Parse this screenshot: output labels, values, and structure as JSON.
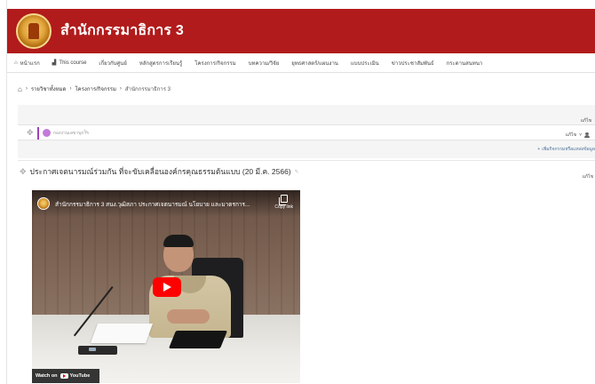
{
  "header": {
    "site_title": "สำนักกรรมาธิการ 3"
  },
  "nav": {
    "items": [
      {
        "icon": "home-icon",
        "label": "หน้าแรก"
      },
      {
        "icon": "chart-icon",
        "label": "This course"
      },
      {
        "label": "เกี่ยวกับศูนย์"
      },
      {
        "label": "หลักสูตรการเรียนรู้"
      },
      {
        "label": "โครงการ/กิจกรรม"
      },
      {
        "label": "บทความ/วิจัย"
      },
      {
        "label": "ยุทธศาสตร์/แผนงาน"
      },
      {
        "label": "แบบประเมิน"
      },
      {
        "label": "ข่าวประชาสัมพันธ์"
      },
      {
        "label": "กระดานสนทนา"
      }
    ]
  },
  "breadcrumb": {
    "items": [
      "รายวิชาทั้งหมด",
      "โครงการ/กิจกรรม",
      "สำนักกรรมาธิการ 3"
    ],
    "separator": "›"
  },
  "edit_panel": {
    "edit_label": "แก้ไข",
    "section_name": "กองงานเลขานุการ",
    "edit_user_label": "แก้ไข",
    "add_activity_label": "เพิ่มกิจกรรมหรือแหล่งข้อมูล"
  },
  "announcement": {
    "title": "ประกาศเจตนารมณ์ร่วมกัน ที่จะขับเคลื่อนองค์กรคุณธรรมต้นแบบ (20 มี.ค. 2566)",
    "edit_label": "แก้ไข"
  },
  "video": {
    "title": "สำนักกรรมาธิการ 3 สนง.วุฒิสภา ประกาศเจตนารมณ์ นโยบาย และมาตรการ...",
    "copy_link_label": "Copy link",
    "watch_on_label": "Watch on",
    "youtube_label": "YouTube"
  }
}
